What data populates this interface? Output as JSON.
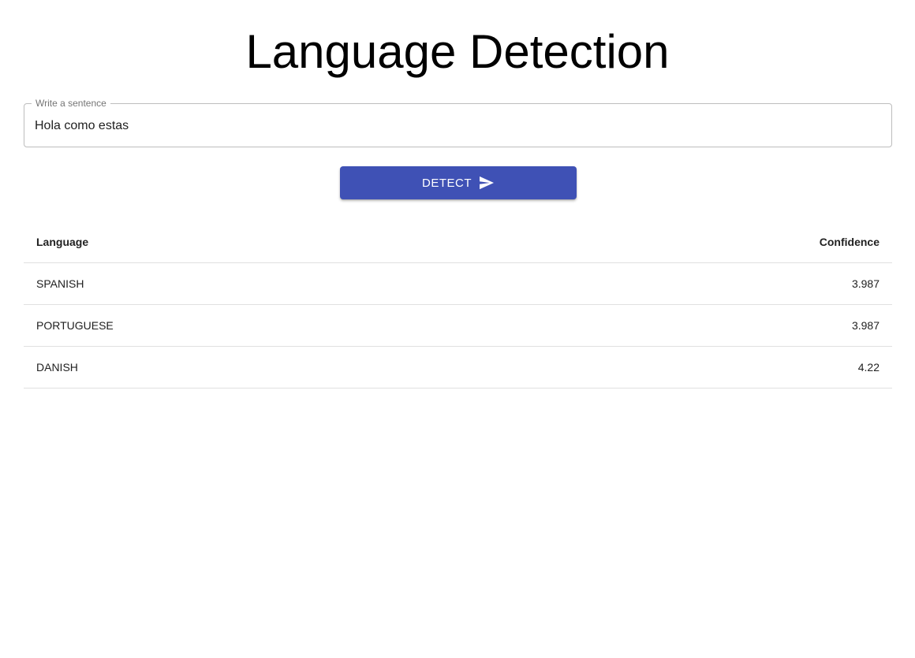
{
  "header": {
    "title": "Language Detection"
  },
  "form": {
    "input_label": "Write a sentence",
    "input_value": "Hola como estas",
    "detect_label": "DETECT",
    "detect_icon": "send-icon",
    "accent_color": "#3f51b5"
  },
  "table": {
    "columns": [
      "Language",
      "Confidence"
    ],
    "rows": [
      {
        "language": "SPANISH",
        "confidence": "3.987"
      },
      {
        "language": "PORTUGUESE",
        "confidence": "3.987"
      },
      {
        "language": "DANISH",
        "confidence": "4.22"
      }
    ]
  }
}
